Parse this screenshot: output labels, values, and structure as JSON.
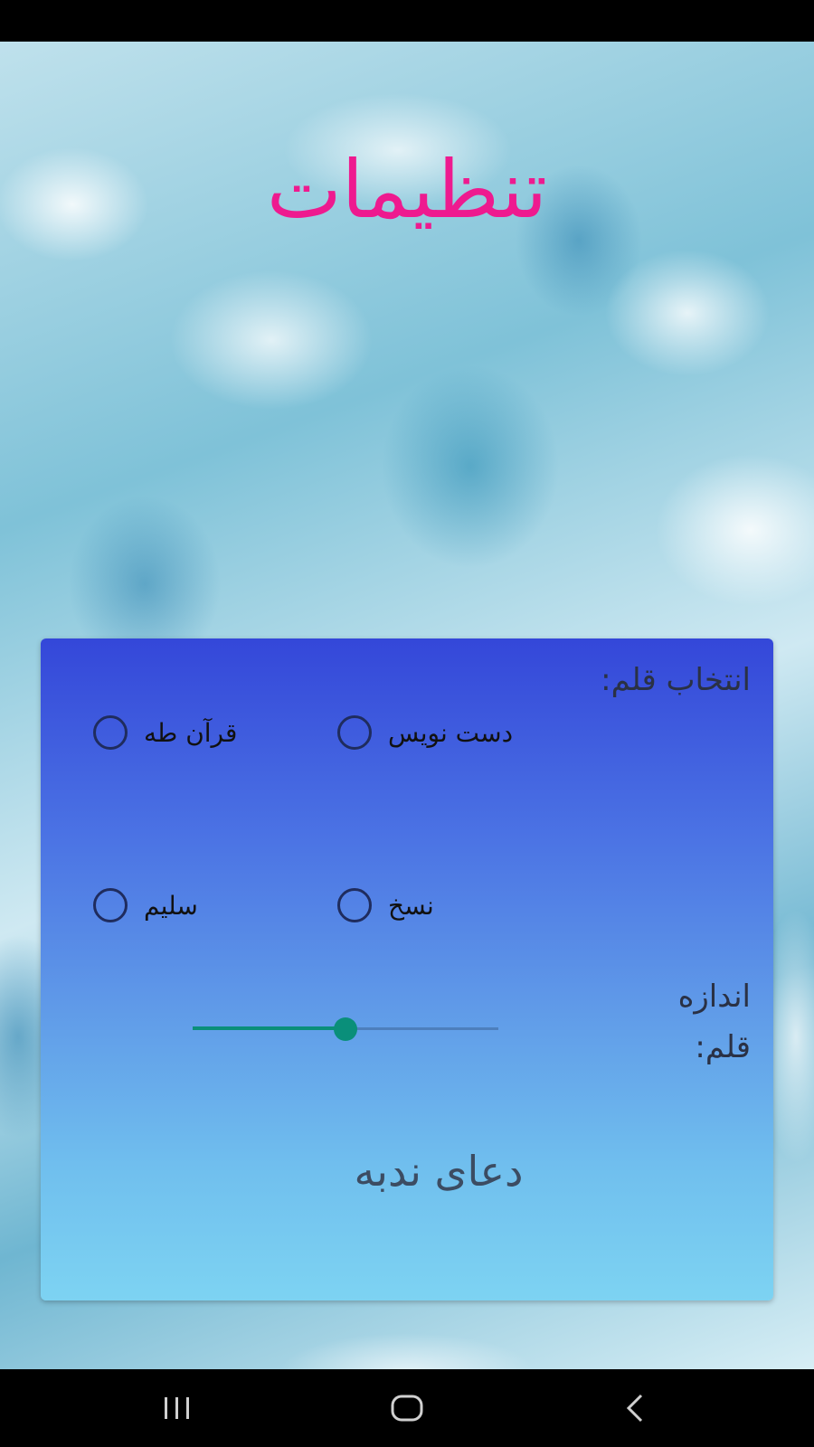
{
  "title": "تنظیمات",
  "settings": {
    "font_label": "انتخاب قلم:",
    "fonts": [
      {
        "label": "قرآن طه",
        "selected": false
      },
      {
        "label": "دست نویس",
        "selected": false
      },
      {
        "label": "سلیم",
        "selected": false
      },
      {
        "label": "نسخ",
        "selected": false
      }
    ],
    "size_label_line1": "اندازه",
    "size_label_line2": "قلم:",
    "font_size_fraction": 0.5,
    "preview_text": "دعای ندبه"
  },
  "colors": {
    "title": "#ee1a8f",
    "accent": "#0a8f7a",
    "card_top": "#3447d9",
    "card_bottom": "#7dd3f2"
  },
  "nav": {
    "recent_icon": "recent-apps-icon",
    "home_icon": "home-icon",
    "back_icon": "back-icon"
  }
}
